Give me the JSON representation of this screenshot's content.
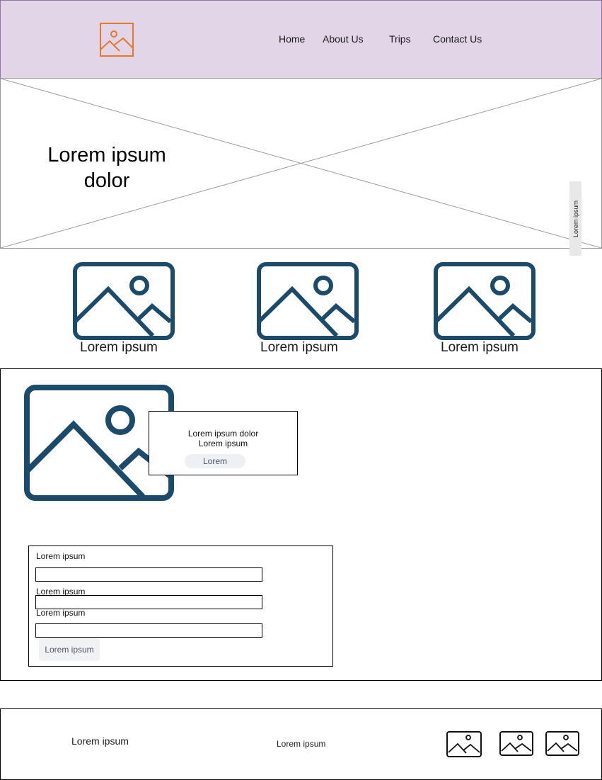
{
  "header": {
    "logo_icon": "image-icon",
    "logo_color": "#e8772e",
    "background": "#e1d5e7",
    "nav": [
      {
        "label": "Home"
      },
      {
        "label": "About Us"
      },
      {
        "label": "Trips"
      },
      {
        "label": "Contact Us"
      }
    ]
  },
  "hero": {
    "title_line1": "Lorem ipsum",
    "title_line2": "dolor",
    "side_tab_label": "Lorem ipsum"
  },
  "features": [
    {
      "icon": "image-icon",
      "label": "Lorem ipsum"
    },
    {
      "icon": "image-icon",
      "label": "Lorem ipsum"
    },
    {
      "icon": "image-icon",
      "label": "Lorem ipsum"
    }
  ],
  "main": {
    "image_icon": "image-icon",
    "image_color": "#1b4a6b",
    "card": {
      "line1": "Lorem ipsum dolor",
      "line2": "Lorem ipsum",
      "button_label": "Lorem"
    },
    "form": {
      "fields": [
        {
          "label": "Lorem ipsum",
          "value": ""
        },
        {
          "label": "Lorem ipsum",
          "value": ""
        },
        {
          "label": "Lorem ipsum",
          "value": ""
        }
      ],
      "submit_label": "Lorem ipsum"
    }
  },
  "footer": {
    "text_left": "Lorem ipsum",
    "text_center": "Lorem ipsum",
    "icons": [
      "image-icon",
      "image-icon",
      "image-icon"
    ]
  }
}
